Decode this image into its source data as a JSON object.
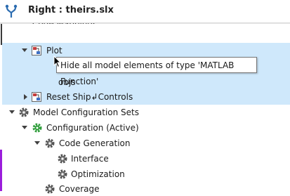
{
  "header": {
    "title": "Right : theirs.slx"
  },
  "clipped_top_label": "Code Mappings",
  "tree": {
    "plot": {
      "label": "Plot",
      "expanded": true
    },
    "objs": {
      "label": "objs"
    },
    "reset": {
      "label": "Reset Ship↲Controls",
      "expanded": false
    },
    "model_config_sets": {
      "label": "Model Configuration Sets",
      "expanded": true
    },
    "configuration": {
      "label": "Configuration (Active)",
      "expanded": true
    },
    "code_generation": {
      "label": "Code Generation",
      "expanded": true
    },
    "interface": {
      "label": "Interface"
    },
    "optimization": {
      "label": "Optimization"
    },
    "coverage": {
      "label": "Coverage"
    }
  },
  "tooltip": {
    "text": "Hide all model elements of type 'MATLAB Function'"
  },
  "colors": {
    "selection": "#cfe8fb",
    "change_marker": "#9b1ddb",
    "merge_icon": "#2b6cb0",
    "active_config_icon": "#2e9d3a"
  }
}
